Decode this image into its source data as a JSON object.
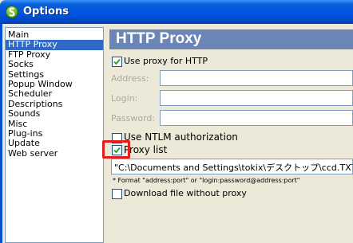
{
  "window": {
    "title": "Options",
    "icon": "app-globe-icon",
    "title_color": "#0054e3"
  },
  "nav": {
    "selected": "HTTP Proxy",
    "items": [
      "Main",
      "HTTP Proxy",
      "FTP Proxy",
      "Socks",
      "Settings",
      "Popup Window",
      "Scheduler",
      "Descriptions",
      "Sounds",
      "Misc",
      "Plug-ins",
      "Update",
      "Web server"
    ]
  },
  "panel": {
    "header": "HTTP Proxy",
    "header_color": "#6b86b6",
    "use_proxy": {
      "label": "Use proxy for HTTP",
      "checked": true
    },
    "address": {
      "label": "Address:",
      "value": ""
    },
    "login": {
      "label": "Login:",
      "value": ""
    },
    "password": {
      "label": "Password:",
      "value": ""
    },
    "ntlm": {
      "label": "Use NTLM authorization",
      "checked": false
    },
    "proxy_list": {
      "label": "Proxy list",
      "checked": true,
      "path": "\"C:\\Documents and Settings\\tokix\\デスクトップ\\ccd.TXT\""
    },
    "format_note": "* Format \"address:port\" or \"login:password@address:port\"",
    "download_direct": {
      "label": "Download file without proxy",
      "checked": false
    }
  },
  "annotation": {
    "highlight_color": "#e41e1e"
  }
}
